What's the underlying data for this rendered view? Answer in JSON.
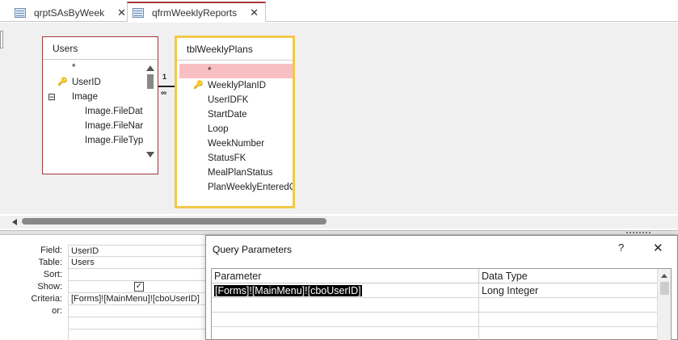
{
  "tabs": [
    {
      "label": "qrptSAsByWeek",
      "close": "✕"
    },
    {
      "label": "qfrmWeeklyReports",
      "close": "✕"
    }
  ],
  "users_table": {
    "title": "Users",
    "fields": [
      "*",
      "UserID",
      "Image",
      "Image.FileDat",
      "Image.FileNar",
      "Image.FileTyp"
    ],
    "key_field": "UserID",
    "expand_symbol": "⊟"
  },
  "weekly_table": {
    "title": "tblWeeklyPlans",
    "fields": [
      "*",
      "WeeklyPlanID",
      "UserIDFK",
      "StartDate",
      "Loop",
      "WeekNumber",
      "StatusFK",
      "MealPlanStatus",
      "PlanWeeklyEnteredC"
    ],
    "key_field": "WeeklyPlanID"
  },
  "relationship": {
    "one": "1",
    "many": "∞"
  },
  "qbe": {
    "labels": {
      "field": "Field:",
      "table": "Table:",
      "sort": "Sort:",
      "show": "Show:",
      "criteria": "Criteria:",
      "or": "or:"
    },
    "column": {
      "field": "UserID",
      "table": "Users",
      "sort": "",
      "show": "✓",
      "criteria": "[Forms]![MainMenu]![cboUserID]",
      "or": ""
    }
  },
  "dialog": {
    "title": "Query Parameters",
    "help": "?",
    "close": "✕",
    "columns": [
      "Parameter",
      "Data Type"
    ],
    "rows": [
      {
        "parameter": "[Forms]![MainMenu]![cboUserID]",
        "data_type": "Long Integer"
      }
    ]
  }
}
